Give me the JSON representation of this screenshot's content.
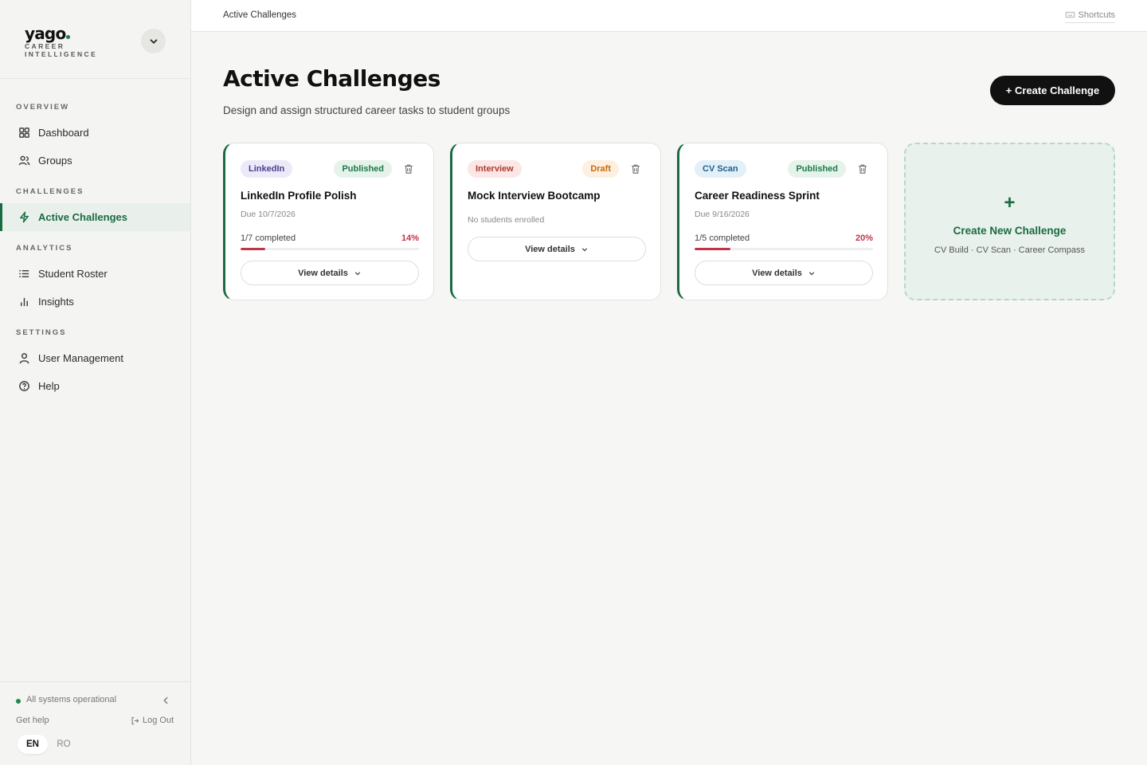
{
  "brand": {
    "logo": "yago",
    "subtitle": "CAREER INTELLIGENCE"
  },
  "sidebar": {
    "sections": [
      "OVERVIEW",
      "CHALLENGES",
      "ANALYTICS",
      "SETTINGS"
    ],
    "items": [
      {
        "label": "Dashboard",
        "icon": "grid-icon"
      },
      {
        "label": "Groups",
        "icon": "users-icon"
      },
      {
        "label": "Active Challenges",
        "icon": "lightning-icon",
        "active": true
      },
      {
        "label": "Student Roster",
        "icon": "list-icon"
      },
      {
        "label": "Insights",
        "icon": "bar-chart-icon"
      },
      {
        "label": "User Management",
        "icon": "user-icon"
      },
      {
        "label": "Help",
        "icon": "help-icon"
      }
    ],
    "footer": {
      "status": "All systems operational",
      "get_help": "Get help",
      "logout": "Log Out",
      "lang_en": "EN",
      "lang_ro": "RO"
    }
  },
  "topbar": {
    "breadcrumb": "Active Challenges",
    "shortcuts": "Shortcuts"
  },
  "header": {
    "title": "Active Challenges",
    "subtitle": "Design and assign structured career tasks to student groups",
    "create_label": "+ Create Challenge"
  },
  "cards": [
    {
      "type": "LinkedIn",
      "type_bg": "#ece9f8",
      "type_color": "#4a3f8f",
      "status": "Published",
      "status_bg": "#e6f3ea",
      "status_color": "#1a7a4a",
      "title": "LinkedIn Profile Polish",
      "due": "Due 10/7/2026",
      "progress_label": "1/7 completed",
      "progress_pct": "14%",
      "progress": 0.14,
      "view": "View details"
    },
    {
      "type": "Interview",
      "type_bg": "#fbe8e6",
      "type_color": "#b0392f",
      "status": "Draft",
      "status_bg": "#fdf0e0",
      "status_color": "#c46a12",
      "title": "Mock Interview Bootcamp",
      "empty": "No students enrolled",
      "view": "View details"
    },
    {
      "type": "CV Scan",
      "type_bg": "#e4f0f8",
      "type_color": "#1f5f8a",
      "status": "Published",
      "status_bg": "#e6f3ea",
      "status_color": "#1a7a4a",
      "title": "Career Readiness Sprint",
      "due": "Due 9/16/2026",
      "progress_label": "1/5 completed",
      "progress_pct": "20%",
      "progress": 0.2,
      "view": "View details"
    }
  ],
  "new_card": {
    "plus": "+",
    "title": "Create New Challenge",
    "subtitle": "CV Build · CV Scan · Career Compass"
  }
}
